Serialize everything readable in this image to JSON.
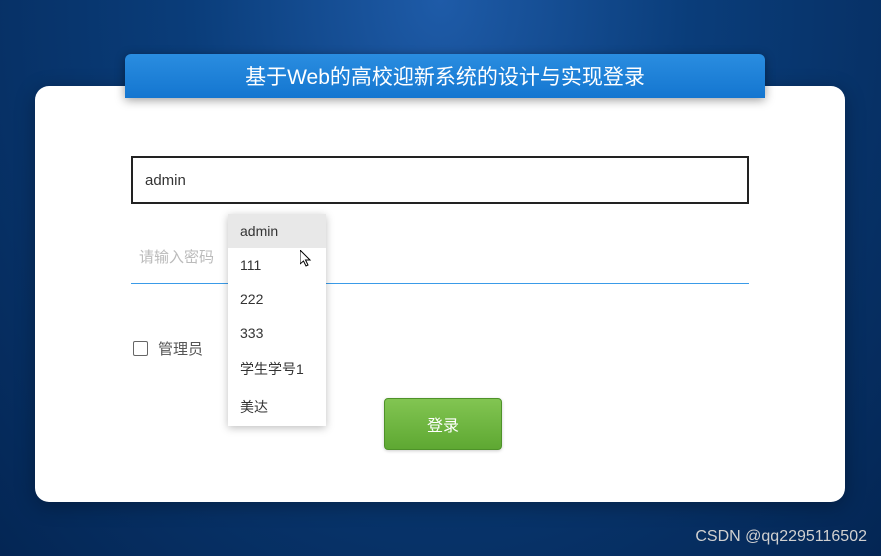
{
  "header": {
    "title": "基于Web的高校迎新系统的设计与实现登录"
  },
  "form": {
    "username_value": "admin",
    "password_placeholder": "请输入密码",
    "admin_checkbox_label": "管理员",
    "login_button_label": "登录"
  },
  "autocomplete": {
    "items": [
      "admin",
      "111",
      "222",
      "333",
      "学生学号1",
      "美达"
    ]
  },
  "watermark": "CSDN @qq2295116502"
}
